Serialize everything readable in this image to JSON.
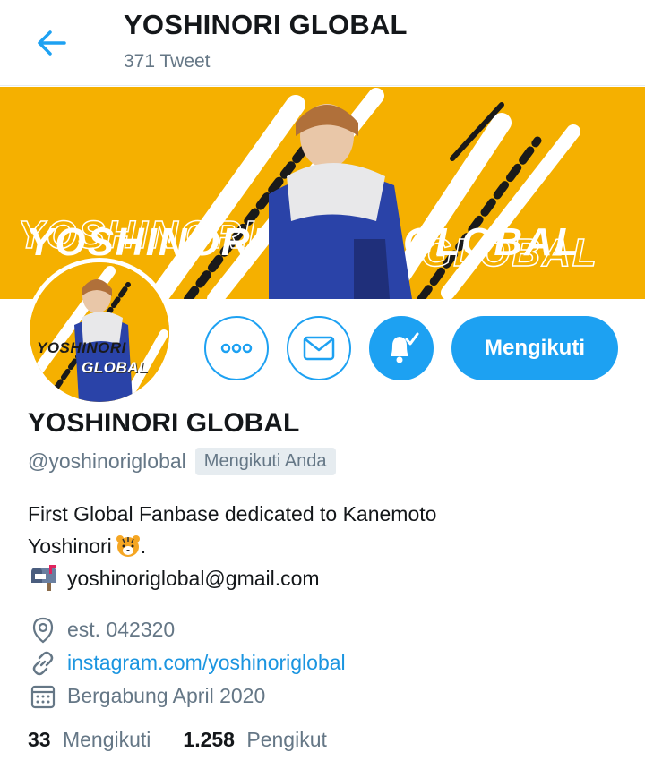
{
  "header": {
    "title": "YOSHINORI GLOBAL",
    "subtitle": "371 Tweet"
  },
  "banner": {
    "text_primary": "YOSHINORI",
    "text_secondary": "GLOBAL",
    "background_color": "#f5b000"
  },
  "avatar": {
    "line1": "YOSHINORI",
    "line2": "GLOBAL"
  },
  "actions": {
    "more_icon": "more-icon",
    "message_icon": "mail-icon",
    "notify_icon": "bell-check-icon",
    "follow_label": "Mengikuti"
  },
  "profile": {
    "name": "YOSHINORI GLOBAL",
    "handle": "@yoshinoriglobal",
    "follows_you": "Mengikuti Anda",
    "bio_line1": "First Global Fanbase dedicated to Kanemoto",
    "bio_line2": "Yoshinori",
    "bio_line2_suffix": ".",
    "bio_email": "yoshinoriglobal@gmail.com",
    "location": "est. 042320",
    "website": "instagram.com/yoshinoriglobal",
    "joined": "Bergabung April 2020"
  },
  "stats": {
    "following_count": "33",
    "following_label": "Mengikuti",
    "followers_count": "1.258",
    "followers_label": "Pengikut"
  },
  "colors": {
    "accent": "#1da1f2",
    "muted": "#657786",
    "link": "#1b95e0"
  }
}
